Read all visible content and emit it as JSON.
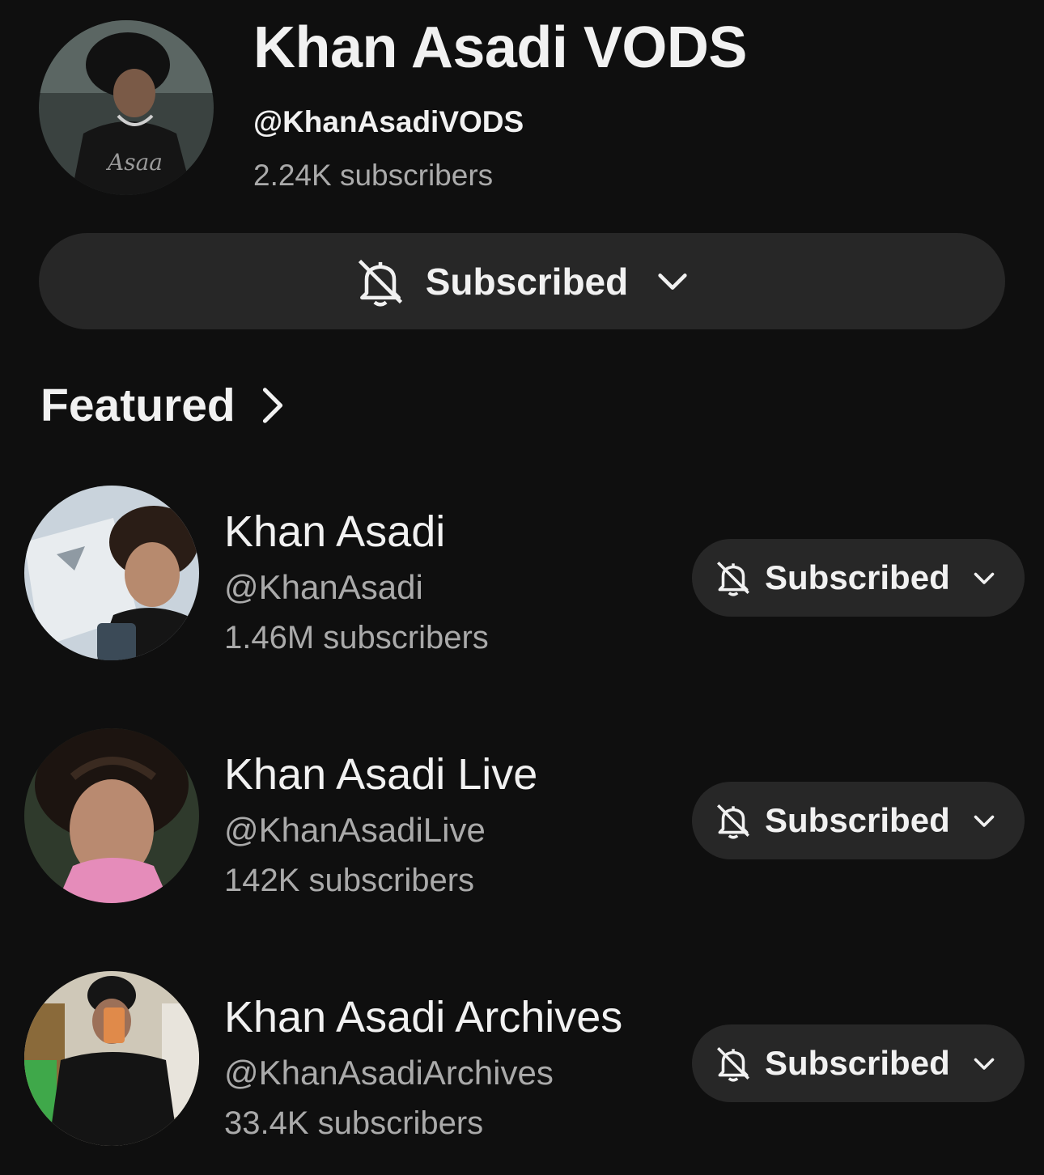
{
  "channel": {
    "title": "Khan Asadi VODS",
    "handle": "@KhanAsadiVODS",
    "subscribers": "2.24K subscribers",
    "subscribe_label": "Subscribed"
  },
  "featured": {
    "title": "Featured",
    "channels": [
      {
        "name": "Khan Asadi",
        "handle": "@KhanAsadi",
        "subscribers": "1.46M subscribers",
        "button_label": "Subscribed"
      },
      {
        "name": "Khan Asadi Live",
        "handle": "@KhanAsadiLive",
        "subscribers": "142K subscribers",
        "button_label": "Subscribed"
      },
      {
        "name": "Khan Asadi Archives",
        "handle": "@KhanAsadiArchives",
        "subscribers": "33.4K subscribers",
        "button_label": "Subscribed"
      }
    ]
  },
  "icons": {
    "bell": "bell-off-icon",
    "chevron": "chevron-down-icon",
    "featured_chevron": "chevron-right-icon"
  },
  "colors": {
    "background": "#0f0f0f",
    "button_bg": "#272727",
    "primary_text": "#f1f1f1",
    "secondary_text": "#aaaaaa"
  }
}
